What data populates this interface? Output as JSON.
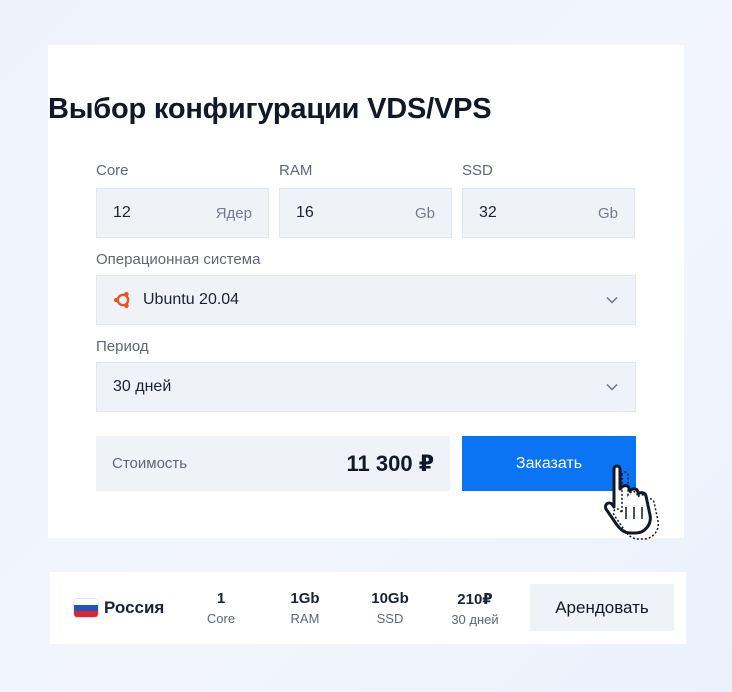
{
  "config": {
    "title": "Выбор конфигурации VDS/VPS",
    "core": {
      "label": "Core",
      "value": "12",
      "unit": "Ядер"
    },
    "ram": {
      "label": "RAM",
      "value": "16",
      "unit": "Gb"
    },
    "ssd": {
      "label": "SSD",
      "value": "32",
      "unit": "Gb"
    },
    "os": {
      "label": "Операционная система",
      "value": "Ubuntu 20.04",
      "icon": "ubuntu-icon"
    },
    "period": {
      "label": "Период",
      "value": "30 дней"
    },
    "cost": {
      "label": "Стоимость",
      "value": "11 300 ₽"
    },
    "order_button": "Заказать",
    "colors": {
      "accent": "#0a74f5",
      "field_bg": "#eff3f8",
      "ubuntu": "#e95420"
    }
  },
  "plan": {
    "country": "Россия",
    "flag_colors": [
      "#ffffff",
      "#1c55c7",
      "#e3242b"
    ],
    "core": {
      "value": "1",
      "label": "Core"
    },
    "ram": {
      "value": "1Gb",
      "label": "RAM"
    },
    "ssd": {
      "value": "10Gb",
      "label": "SSD"
    },
    "price": {
      "value": "210₽",
      "label": "30 дней"
    },
    "rent_button": "Арендовать"
  }
}
